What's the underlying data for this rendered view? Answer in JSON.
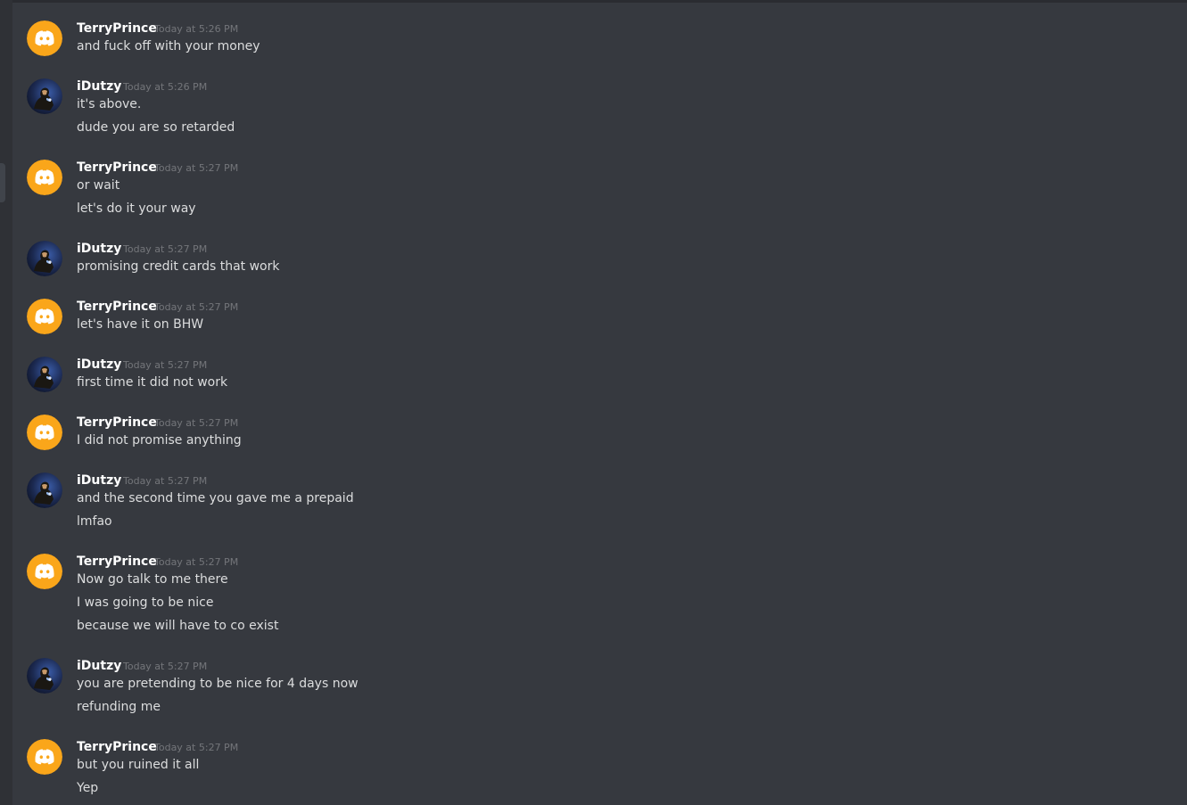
{
  "theme": {
    "background": "#36393f",
    "sidebar": "#2f3136",
    "discord_avatar": "#faa61a",
    "text": "#dcddde",
    "username": "#ffffff"
  },
  "messages": [
    {
      "author": "TerryPrince",
      "avatar": "discord-logo-icon",
      "timestamp": "Today at 5:26 PM",
      "lines": [
        "and fuck off with your money"
      ]
    },
    {
      "author": "iDutzy",
      "avatar": "user-avatar-icon",
      "timestamp": "Today at 5:26 PM",
      "lines": [
        "it's above.",
        "dude you are so retarded"
      ]
    },
    {
      "author": "TerryPrince",
      "avatar": "discord-logo-icon",
      "timestamp": "Today at 5:27 PM",
      "lines": [
        "or wait",
        "let's do it your way"
      ]
    },
    {
      "author": "iDutzy",
      "avatar": "user-avatar-icon",
      "timestamp": "Today at 5:27 PM",
      "lines": [
        "promising credit cards that work"
      ]
    },
    {
      "author": "TerryPrince",
      "avatar": "discord-logo-icon",
      "timestamp": "Today at 5:27 PM",
      "lines": [
        "let's have it on BHW"
      ]
    },
    {
      "author": "iDutzy",
      "avatar": "user-avatar-icon",
      "timestamp": "Today at 5:27 PM",
      "lines": [
        "first time it did not work"
      ]
    },
    {
      "author": "TerryPrince",
      "avatar": "discord-logo-icon",
      "timestamp": "Today at 5:27 PM",
      "lines": [
        "I did not promise anything"
      ]
    },
    {
      "author": "iDutzy",
      "avatar": "user-avatar-icon",
      "timestamp": "Today at 5:27 PM",
      "lines": [
        "and the second time you gave me a prepaid",
        "lmfao"
      ]
    },
    {
      "author": "TerryPrince",
      "avatar": "discord-logo-icon",
      "timestamp": "Today at 5:27 PM",
      "lines": [
        "Now go talk to me there",
        "I was going to be nice",
        "because we will have to co exist"
      ]
    },
    {
      "author": "iDutzy",
      "avatar": "user-avatar-icon",
      "timestamp": "Today at 5:27 PM",
      "lines": [
        "you are pretending to be nice for 4 days now",
        "refunding me"
      ]
    },
    {
      "author": "TerryPrince",
      "avatar": "discord-logo-icon",
      "timestamp": "Today at 5:27 PM",
      "lines": [
        "but you ruined it all",
        "Yep"
      ]
    }
  ]
}
